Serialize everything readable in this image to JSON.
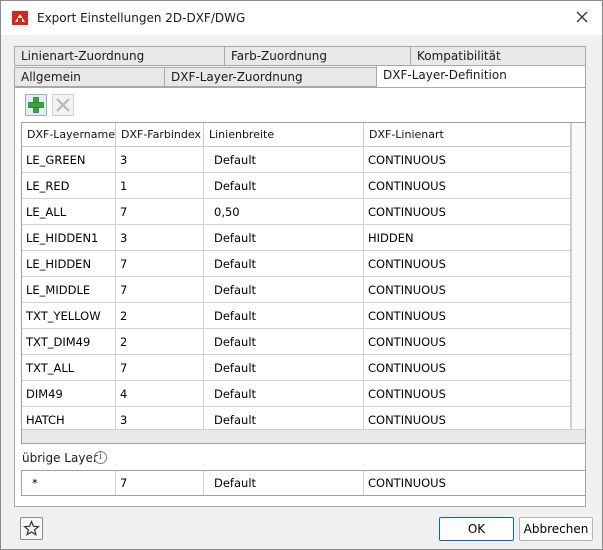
{
  "window": {
    "title": "Export Einstellungen 2D-DXF/DWG"
  },
  "tabs": {
    "row1": [
      "Linienart-Zuordnung",
      "Farb-Zuordnung",
      "Kompatibilität"
    ],
    "row2": [
      "Allgemein",
      "DXF-Layer-Zuordnung",
      "DXF-Layer-Definition"
    ],
    "active": "DXF-Layer-Definition"
  },
  "toolbar": {
    "add_icon": "plus-icon",
    "delete_icon": "delete-icon"
  },
  "table": {
    "columns": [
      "DXF-Layername",
      "DXF-Farbindex",
      "Linienbreite",
      "DXF-Linienart"
    ],
    "rows": [
      [
        "LE_GREEN",
        "3",
        "Default",
        "CONTINUOUS"
      ],
      [
        "LE_RED",
        "1",
        "Default",
        "CONTINUOUS"
      ],
      [
        "LE_ALL",
        "7",
        "0,50",
        "CONTINUOUS"
      ],
      [
        "LE_HIDDEN1",
        "3",
        "Default",
        "HIDDEN"
      ],
      [
        "LE_HIDDEN",
        "7",
        "Default",
        "CONTINUOUS"
      ],
      [
        "LE_MIDDLE",
        "7",
        "Default",
        "CONTINUOUS"
      ],
      [
        "TXT_YELLOW",
        "2",
        "Default",
        "CONTINUOUS"
      ],
      [
        "TXT_DIM49",
        "2",
        "Default",
        "CONTINUOUS"
      ],
      [
        "TXT_ALL",
        "7",
        "Default",
        "CONTINUOUS"
      ],
      [
        "DIM49",
        "4",
        "Default",
        "CONTINUOUS"
      ],
      [
        "HATCH",
        "3",
        "Default",
        "CONTINUOUS"
      ]
    ]
  },
  "other_layers": {
    "label": "übrige Layer",
    "info_icon": "i",
    "row": [
      "*",
      "7",
      "Default",
      "CONTINUOUS"
    ]
  },
  "buttons": {
    "ok": "OK",
    "cancel": "Abbrechen"
  },
  "colors": {
    "accent": "#0067c0",
    "add_green": "#3aa63a"
  }
}
